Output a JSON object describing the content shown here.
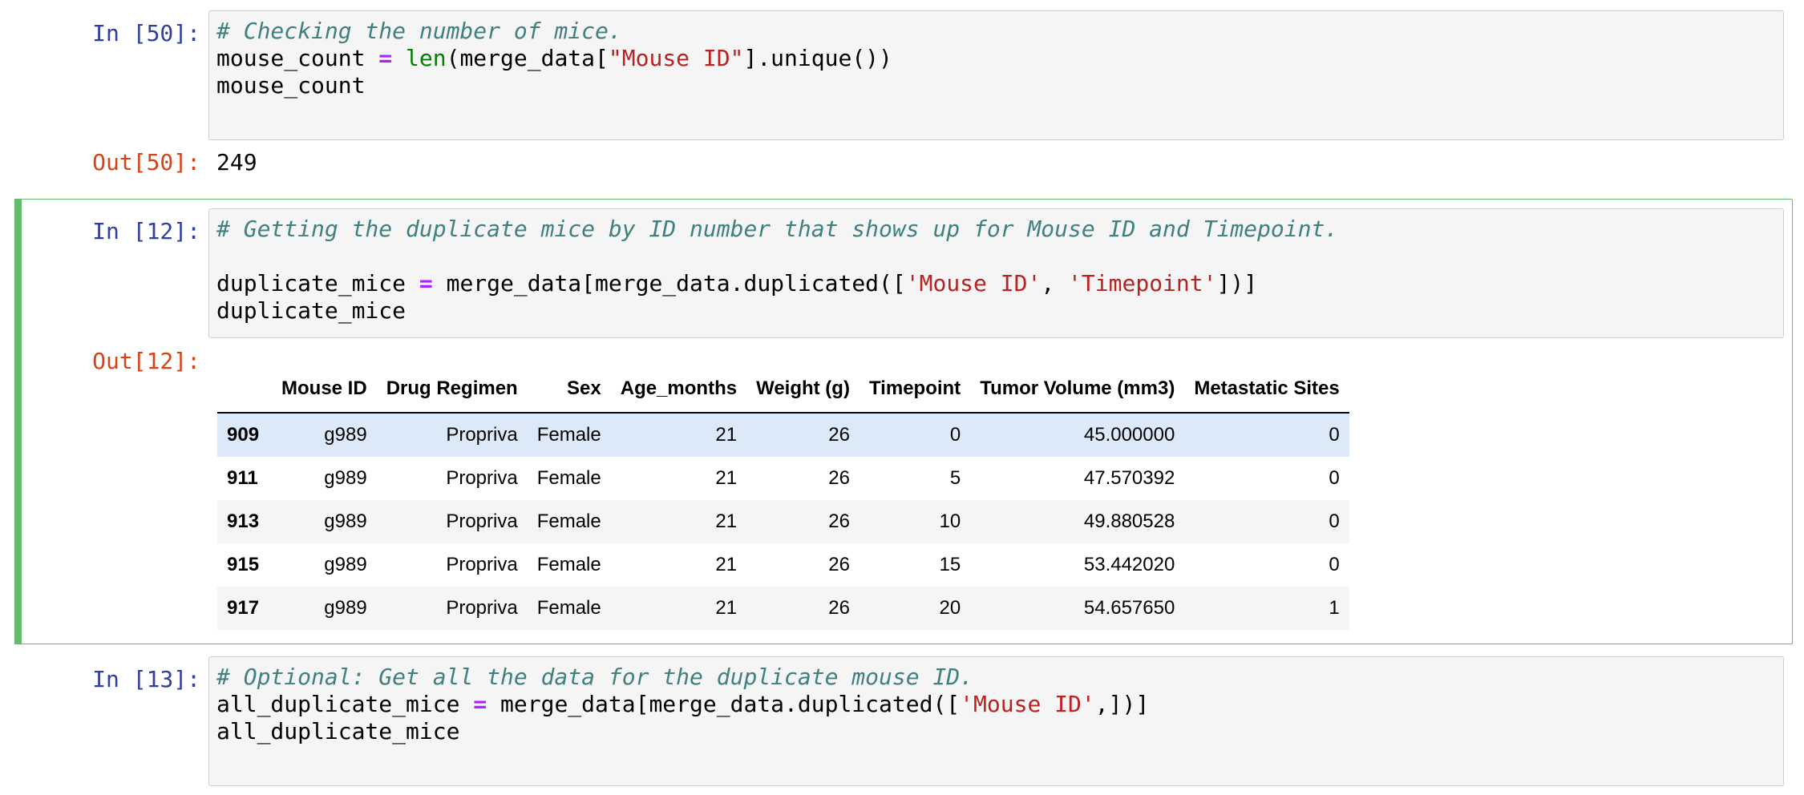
{
  "cells": [
    {
      "in_prompt": "In [50]:",
      "code": [
        [
          {
            "t": "cm",
            "v": "# Checking the number of mice."
          }
        ],
        [
          {
            "t": "",
            "v": "mouse_count "
          },
          {
            "t": "op",
            "v": "="
          },
          {
            "t": "",
            "v": " "
          },
          {
            "t": "bi",
            "v": "len"
          },
          {
            "t": "",
            "v": "(merge_data["
          },
          {
            "t": "st",
            "v": "\"Mouse ID\""
          },
          {
            "t": "",
            "v": "].unique())"
          }
        ],
        [
          {
            "t": "",
            "v": "mouse_count"
          }
        ]
      ],
      "out_prompt": "Out[50]:",
      "output_text": "249"
    },
    {
      "in_prompt": "In [12]:",
      "code": [
        [
          {
            "t": "cm",
            "v": "# Getting the duplicate mice by ID number that shows up for Mouse ID and Timepoint."
          }
        ],
        [],
        [
          {
            "t": "",
            "v": "duplicate_mice "
          },
          {
            "t": "op",
            "v": "="
          },
          {
            "t": "",
            "v": " merge_data[merge_data.duplicated(["
          },
          {
            "t": "st",
            "v": "'Mouse ID'"
          },
          {
            "t": "",
            "v": ", "
          },
          {
            "t": "st",
            "v": "'Timepoint'"
          },
          {
            "t": "",
            "v": "])]"
          }
        ],
        [
          {
            "t": "",
            "v": "duplicate_mice"
          }
        ]
      ],
      "out_prompt": "Out[12]:",
      "table": {
        "columns": [
          "",
          "Mouse ID",
          "Drug Regimen",
          "Sex",
          "Age_months",
          "Weight (g)",
          "Timepoint",
          "Tumor Volume (mm3)",
          "Metastatic Sites"
        ],
        "rows": [
          [
            "909",
            "g989",
            "Propriva",
            "Female",
            "21",
            "26",
            "0",
            "45.000000",
            "0"
          ],
          [
            "911",
            "g989",
            "Propriva",
            "Female",
            "21",
            "26",
            "5",
            "47.570392",
            "0"
          ],
          [
            "913",
            "g989",
            "Propriva",
            "Female",
            "21",
            "26",
            "10",
            "49.880528",
            "0"
          ],
          [
            "915",
            "g989",
            "Propriva",
            "Female",
            "21",
            "26",
            "15",
            "53.442020",
            "0"
          ],
          [
            "917",
            "g989",
            "Propriva",
            "Female",
            "21",
            "26",
            "20",
            "54.657650",
            "1"
          ]
        ]
      }
    },
    {
      "in_prompt": "In [13]:",
      "code": [
        [
          {
            "t": "cm",
            "v": "# Optional: Get all the data for the duplicate mouse ID."
          }
        ],
        [
          {
            "t": "",
            "v": "all_duplicate_mice "
          },
          {
            "t": "op",
            "v": "="
          },
          {
            "t": "",
            "v": " merge_data[merge_data.duplicated(["
          },
          {
            "t": "st",
            "v": "'Mouse ID'"
          },
          {
            "t": "",
            "v": ",])]"
          }
        ],
        [
          {
            "t": "",
            "v": "all_duplicate_mice"
          }
        ]
      ]
    }
  ],
  "colors": {
    "prompt_in": "#303f9f",
    "prompt_out": "#d84315",
    "selected_cell_border": "#66bb6a",
    "comment": "#408080",
    "operator": "#aa22ff",
    "builtin": "#008000",
    "string": "#ba2121"
  }
}
